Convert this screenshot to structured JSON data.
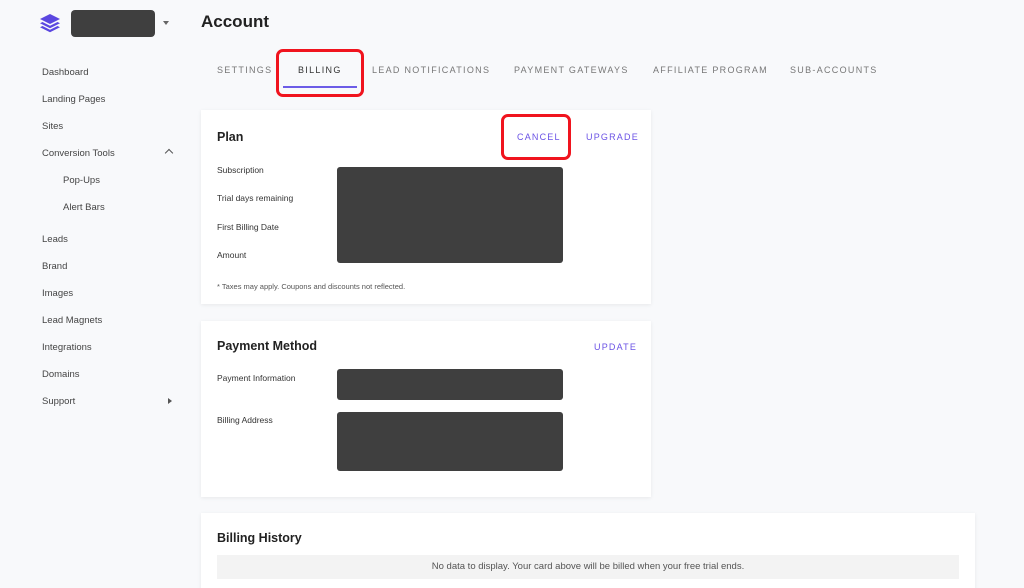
{
  "header": {
    "title": "Account",
    "account_switcher": "[redacted]",
    "brand_color": "#5b47e0"
  },
  "sidebar": {
    "items": [
      {
        "label": "Dashboard"
      },
      {
        "label": "Landing Pages"
      },
      {
        "label": "Sites"
      },
      {
        "label": "Conversion Tools",
        "expanded": true
      },
      {
        "label": "Pop-Ups",
        "sub": true
      },
      {
        "label": "Alert Bars",
        "sub": true
      },
      {
        "label": "Leads"
      },
      {
        "label": "Brand"
      },
      {
        "label": "Images"
      },
      {
        "label": "Lead Magnets"
      },
      {
        "label": "Integrations"
      },
      {
        "label": "Domains"
      },
      {
        "label": "Support",
        "has_submenu": true
      }
    ]
  },
  "tabs": [
    {
      "label": "SETTINGS"
    },
    {
      "label": "BILLING",
      "active": true
    },
    {
      "label": "LEAD NOTIFICATIONS"
    },
    {
      "label": "PAYMENT GATEWAYS"
    },
    {
      "label": "AFFILIATE PROGRAM"
    },
    {
      "label": "SUB-ACCOUNTS"
    }
  ],
  "plan": {
    "title": "Plan",
    "cancel_label": "CANCEL",
    "upgrade_label": "UPGRADE",
    "fields": [
      {
        "label": "Subscription"
      },
      {
        "label": "Trial days remaining"
      },
      {
        "label": "First Billing Date"
      },
      {
        "label": "Amount"
      }
    ],
    "note": "* Taxes may apply. Coupons and discounts not reflected."
  },
  "payment_method": {
    "title": "Payment Method",
    "update_label": "UPDATE",
    "fields": [
      {
        "label": "Payment Information"
      },
      {
        "label": "Billing Address"
      }
    ]
  },
  "billing_history": {
    "title": "Billing History",
    "empty_message": "No data to display. Your card above will be billed when your free trial ends."
  },
  "colors": {
    "accent": "#6a52e5",
    "highlight": "#f0141e",
    "redacted": "#3f3f3f"
  }
}
